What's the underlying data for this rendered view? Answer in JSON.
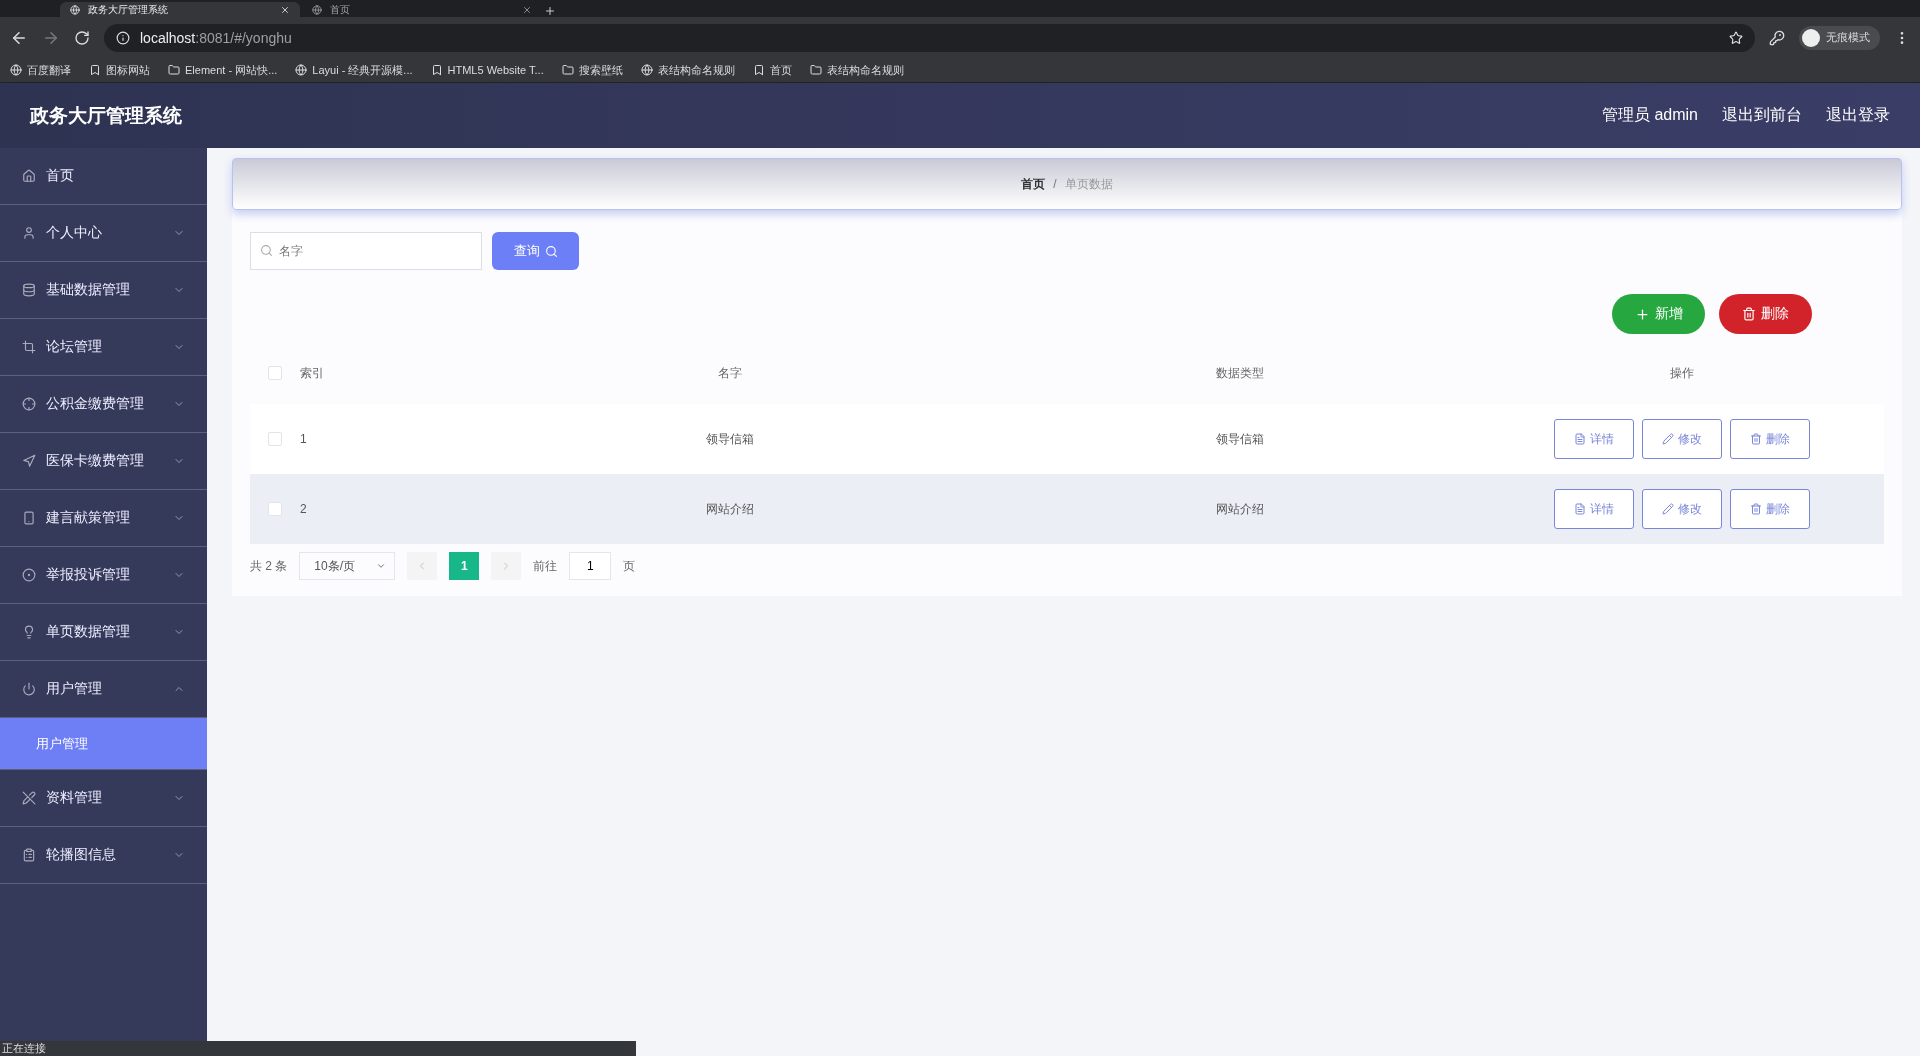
{
  "browser": {
    "tabs": [
      {
        "title": "政务大厅管理系统",
        "selected": true
      },
      {
        "title": "首页",
        "selected": false
      }
    ],
    "url": {
      "host": "localhost",
      "rest": ":8081/#/yonghu"
    },
    "bookmarks": [
      "百度翻译",
      "图标网站",
      "Element - 网站快...",
      "Layui - 经典开源模...",
      "HTML5 Website T...",
      "搜索壁纸",
      "表结构命名规则",
      "首页",
      "表结构命名规则"
    ],
    "profile_label": "无痕模式"
  },
  "header": {
    "title": "政务大厅管理系统",
    "links": [
      "管理员 admin",
      "退出到前台",
      "退出登录"
    ]
  },
  "sidebar": {
    "items": [
      {
        "label": "首页",
        "kind": "link"
      },
      {
        "label": "个人中心",
        "kind": "menu",
        "expanded": false
      },
      {
        "label": "基础数据管理",
        "kind": "menu",
        "expanded": false
      },
      {
        "label": "论坛管理",
        "kind": "menu",
        "expanded": false
      },
      {
        "label": "公积金缴费管理",
        "kind": "menu",
        "expanded": false
      },
      {
        "label": "医保卡缴费管理",
        "kind": "menu",
        "expanded": false
      },
      {
        "label": "建言献策管理",
        "kind": "menu",
        "expanded": false
      },
      {
        "label": "举报投诉管理",
        "kind": "menu",
        "expanded": false
      },
      {
        "label": "单页数据管理",
        "kind": "menu",
        "expanded": false
      },
      {
        "label": "用户管理",
        "kind": "menu",
        "expanded": true,
        "children": [
          {
            "label": "用户管理",
            "selected": true
          }
        ]
      },
      {
        "label": "资料管理",
        "kind": "menu",
        "expanded": false
      },
      {
        "label": "轮播图信息",
        "kind": "menu",
        "expanded": false
      }
    ]
  },
  "breadcrumb": [
    "首页",
    "单页数据"
  ],
  "breadcrumb_separator": "/",
  "search": {
    "placeholder": "名字",
    "button": "查询"
  },
  "actions": [
    {
      "label": "新增",
      "kind": "add"
    },
    {
      "label": "删除",
      "kind": "delete"
    }
  ],
  "table": {
    "all_checked": false,
    "columns": [
      "索引",
      "名字",
      "数据类型",
      "操作"
    ],
    "rows": [
      {
        "checked": false,
        "hovered": false,
        "index": "1",
        "name": "领导信箱",
        "type": "领导信箱",
        "actions": [
          "详情",
          "修改",
          "删除"
        ]
      },
      {
        "checked": false,
        "hovered": true,
        "index": "2",
        "name": "网站介绍",
        "type": "网站介绍",
        "actions": [
          "详情",
          "修改",
          "删除"
        ]
      }
    ]
  },
  "pagination": {
    "total": "共 2 条",
    "page_size": "10条/页",
    "pages": [
      {
        "label": "1",
        "selected": true
      }
    ],
    "goto_label": "前往",
    "goto_value": "1",
    "page_suffix": "页"
  },
  "status_bar": "正在连接"
}
